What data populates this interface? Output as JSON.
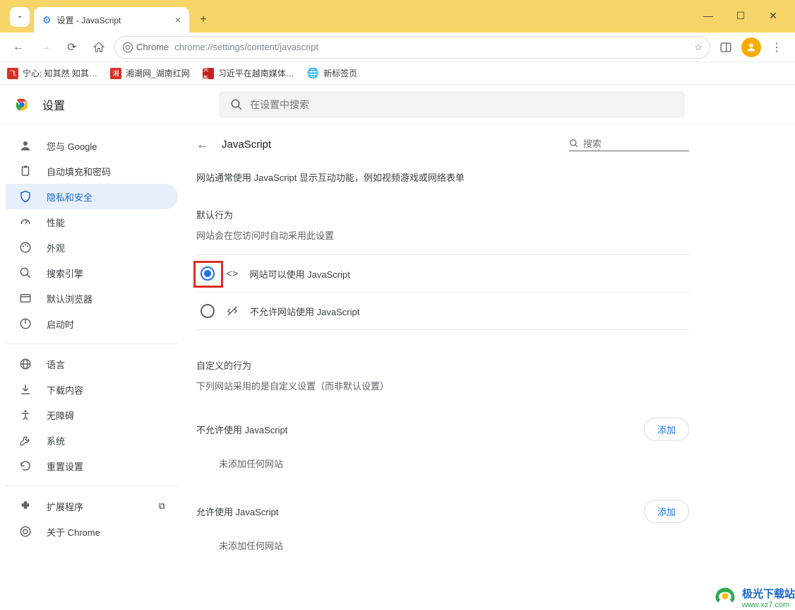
{
  "window": {
    "tab_title": "设置 - JavaScript",
    "url": "chrome://settings/content/javascript",
    "url_prefix": "Chrome"
  },
  "bookmarks": [
    {
      "label": "宁心: 知其然 知其…"
    },
    {
      "label": "湘潮网_湖南红网"
    },
    {
      "label": "习近平在越南媒体…"
    },
    {
      "label": "新标签页"
    }
  ],
  "settings": {
    "app_title": "设置",
    "search_placeholder": "在设置中搜索"
  },
  "sidebar": {
    "items": [
      {
        "label": "您与 Google"
      },
      {
        "label": "自动填充和密码"
      },
      {
        "label": "隐私和安全"
      },
      {
        "label": "性能"
      },
      {
        "label": "外观"
      },
      {
        "label": "搜索引擎"
      },
      {
        "label": "默认浏览器"
      },
      {
        "label": "启动时"
      }
    ],
    "more": [
      {
        "label": "语言"
      },
      {
        "label": "下载内容"
      },
      {
        "label": "无障碍"
      },
      {
        "label": "系统"
      },
      {
        "label": "重置设置"
      }
    ],
    "footer": [
      {
        "label": "扩展程序"
      },
      {
        "label": "关于 Chrome"
      }
    ]
  },
  "page": {
    "title": "JavaScript",
    "search_placeholder": "搜索",
    "intro": "网站通常使用 JavaScript 显示互动功能，例如视频游戏或网络表单",
    "default_heading": "默认行为",
    "default_sub": "网站会在您访问时自动采用此设置",
    "radio_allow": "网站可以使用 JavaScript",
    "radio_block": "不允许网站使用 JavaScript",
    "custom_heading": "自定义的行为",
    "custom_sub": "下列网站采用的是自定义设置（而非默认设置）",
    "block_list_title": "不允许使用 JavaScript",
    "allow_list_title": "允许使用 JavaScript",
    "add_button": "添加",
    "empty": "未添加任何网站"
  },
  "watermark": {
    "line1": "极光下载站",
    "line2": "www.xz7.com"
  }
}
